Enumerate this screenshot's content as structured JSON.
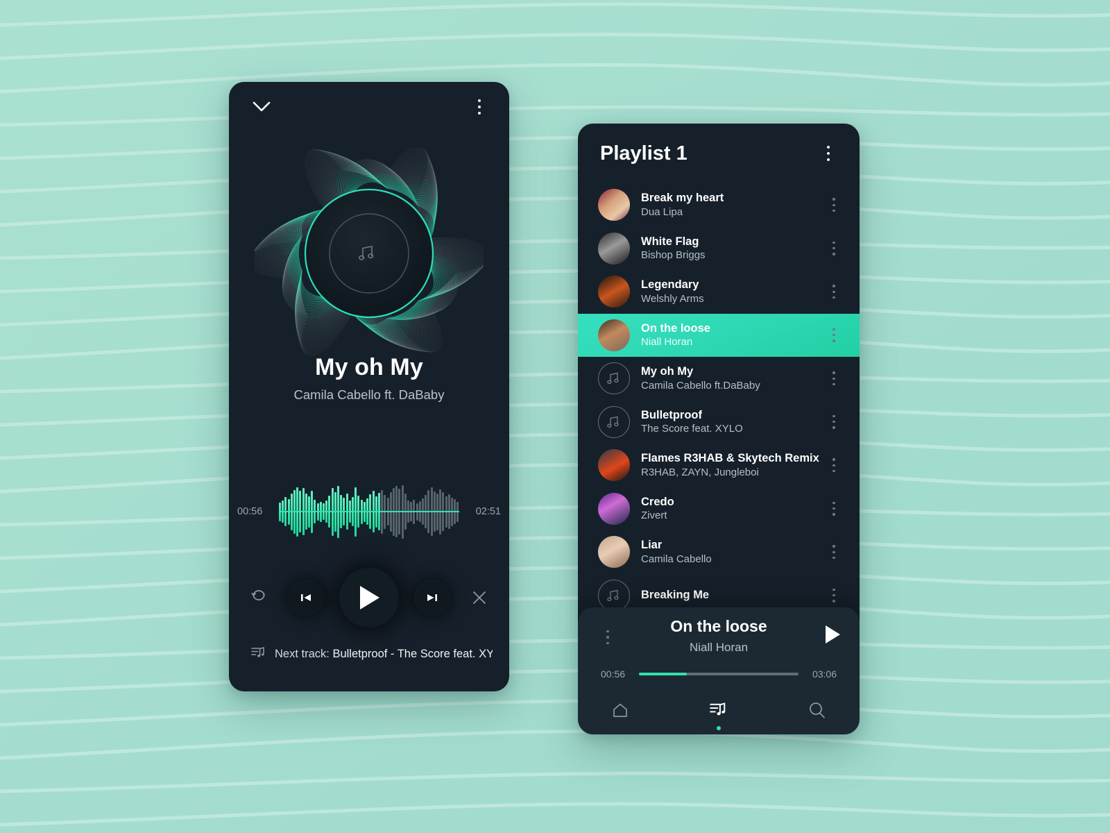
{
  "theme": {
    "background": "#a6ded0",
    "card": "#16202a",
    "accent": "#35e0ac",
    "accent_dark": "#22cfa4",
    "text_primary": "#ffffff",
    "text_secondary": "#b4bfc6"
  },
  "player": {
    "collapse_icon": "chevron-down-icon",
    "menu_icon": "kebab-menu-icon",
    "artwork_icon": "music-note-icon",
    "title": "My oh My",
    "artist": "Camila Cabello ft. DaBaby",
    "elapsed": "00:56",
    "duration": "02:51",
    "progress_percent": 57,
    "controls": {
      "repeat": "repeat-icon",
      "previous": "skip-previous-icon",
      "play": "play-icon",
      "next": "skip-next-icon",
      "close": "close-icon"
    },
    "next_track_label": "Next track:",
    "next_track_value": "Bulletproof - The Score feat. XY...",
    "next_track_icon": "playlist-note-icon"
  },
  "playlist": {
    "title": "Playlist 1",
    "menu_icon": "kebab-menu-icon",
    "tracks": [
      {
        "name": "Break my heart",
        "artist": "Dua Lipa",
        "art": "photo",
        "active": false
      },
      {
        "name": "White Flag",
        "artist": "Bishop Briggs",
        "art": "photo",
        "active": false
      },
      {
        "name": "Legendary",
        "artist": "Welshly Arms",
        "art": "photo",
        "active": false
      },
      {
        "name": "On the loose",
        "artist": "Niall Horan",
        "art": "photo",
        "active": true
      },
      {
        "name": "My oh My",
        "artist": "Camila Cabello ft.DaBaby",
        "art": "note",
        "active": false
      },
      {
        "name": "Bulletproof",
        "artist": "The Score feat. XYLO",
        "art": "note",
        "active": false
      },
      {
        "name": "Flames R3HAB & Skytech Remix",
        "artist": "R3HAB, ZAYN, Jungleboi",
        "art": "photo",
        "active": false
      },
      {
        "name": "Credo",
        "artist": "Zivert",
        "art": "photo",
        "active": false
      },
      {
        "name": "Liar",
        "artist": "Camila Cabello",
        "art": "photo",
        "active": false
      },
      {
        "name": "Breaking Me",
        "artist": "",
        "art": "note",
        "active": false
      }
    ]
  },
  "mini_player": {
    "menu_icon": "kebab-menu-icon",
    "title": "On the loose",
    "artist": "Niall Horan",
    "elapsed": "00:56",
    "duration": "03:06",
    "progress_percent": 30,
    "play_icon": "play-icon",
    "nav": [
      {
        "icon": "home-icon",
        "label": "Home",
        "selected": false
      },
      {
        "icon": "playlist-icon",
        "label": "Playlist",
        "selected": true
      },
      {
        "icon": "search-icon",
        "label": "Search",
        "selected": false
      }
    ]
  }
}
